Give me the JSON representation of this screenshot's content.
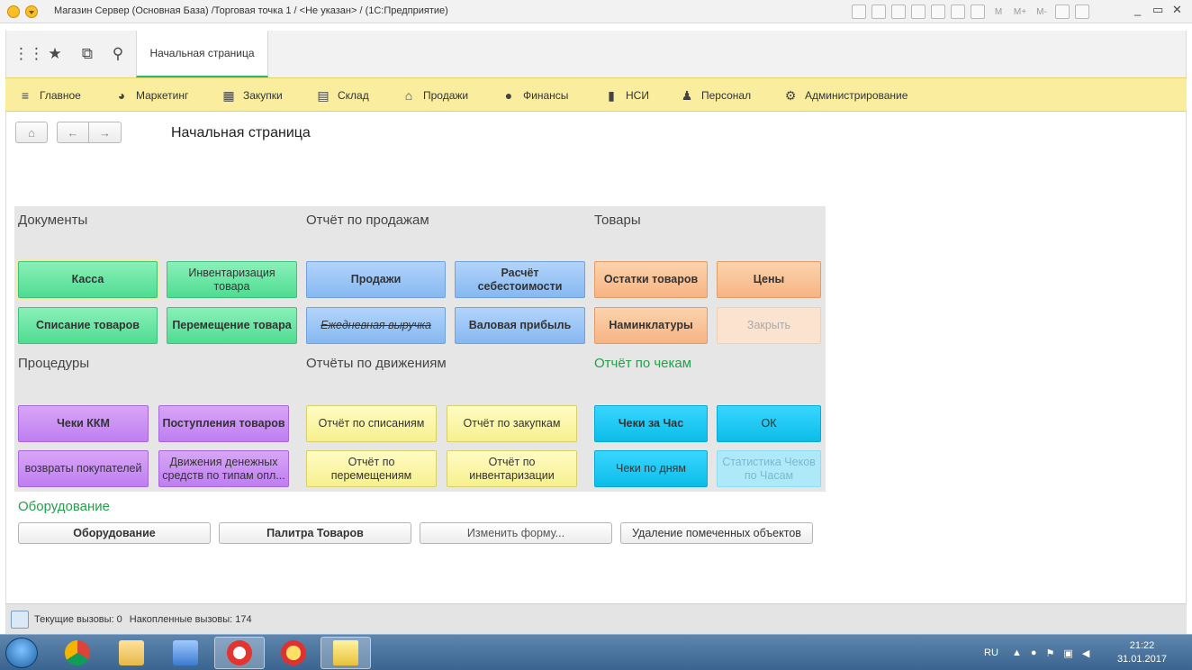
{
  "window": {
    "title": "Магазин Сервер (Основная База) /Торговая точка 1 / <Не указан> / (1С:Предприятие)",
    "toolbar_texts": [
      "M",
      "M+",
      "M-"
    ],
    "controls": [
      "_",
      "▭",
      "✕"
    ]
  },
  "tabs": {
    "home_tab": "Начальная страница"
  },
  "main_menu": [
    {
      "label": "Главное",
      "icon": "hamburger-icon"
    },
    {
      "label": "Маркетинг",
      "icon": "pie-chart-icon"
    },
    {
      "label": "Закупки",
      "icon": "cart-icon"
    },
    {
      "label": "Склад",
      "icon": "warehouse-icon"
    },
    {
      "label": "Продажи",
      "icon": "basket-icon"
    },
    {
      "label": "Финансы",
      "icon": "coin-icon"
    },
    {
      "label": "НСИ",
      "icon": "books-icon"
    },
    {
      "label": "Персонал",
      "icon": "person-icon"
    },
    {
      "label": "Администрирование",
      "icon": "gear-icon"
    }
  ],
  "page": {
    "title": "Начальная страница"
  },
  "groups": {
    "documents": {
      "title": "Документы",
      "buttons": [
        "Касса",
        "Инвентаризация товара",
        "Списание товаров",
        "Перемещение товара"
      ]
    },
    "sales_report": {
      "title": "Отчёт по продажам",
      "buttons": [
        "Продажи",
        "Расчёт себестоимости",
        "Ежедневная выручка",
        "Валовая прибыль"
      ]
    },
    "goods": {
      "title": "Товары",
      "buttons": [
        "Остатки товаров",
        "Цены",
        "Наминклатуры",
        "Закрыть"
      ]
    },
    "procedures": {
      "title": "Процедуры",
      "buttons": [
        "Чеки ККМ",
        "Поступления товаров",
        "возвраты покупателей",
        "Движения денежных средств по типам опл..."
      ]
    },
    "movement_reports": {
      "title": "Отчёты по движениям",
      "buttons": [
        "Отчёт по списаниям",
        "Отчёт по закупкам",
        "Отчёт по перемещениям",
        "Отчёт по инвентаризации"
      ]
    },
    "receipt_report": {
      "title": "Отчёт по чекам",
      "buttons": [
        "Чеки за Час",
        "ОК",
        "Чеки по дням",
        "Статистика Чеков по Часам"
      ]
    },
    "equipment": {
      "title": "Оборудование",
      "buttons": [
        "Оборудование",
        "Палитра Товаров",
        "Изменить форму...",
        "Удаление помеченных объектов"
      ]
    }
  },
  "status": {
    "current_calls": "Текущие вызовы: 0",
    "accumulated_calls": "Накопленные вызовы: 174"
  },
  "taskbar": {
    "lang": "RU",
    "time": "21:22",
    "date": "31.01.2017"
  }
}
